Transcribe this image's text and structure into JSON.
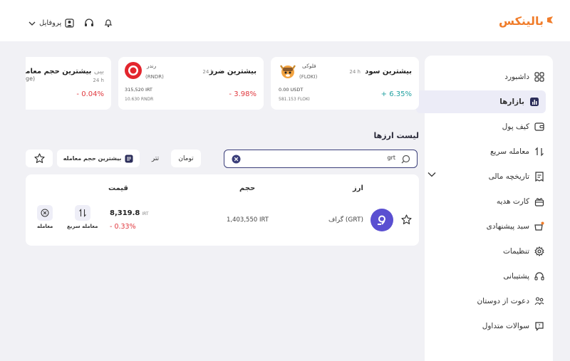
{
  "header": {
    "logo_text": "بالینکس",
    "profile_label": "پروفایل"
  },
  "sidebar": {
    "items": [
      {
        "label": "داشبورد",
        "icon": "dashboard-grid-icon"
      },
      {
        "label": "بازارها",
        "icon": "chart-box-icon",
        "active": true
      },
      {
        "label": "کیف پول",
        "icon": "wallet-icon"
      },
      {
        "label": "معامله سریع",
        "icon": "swap-arrows-icon"
      },
      {
        "label": "تاریخچه مالی",
        "icon": "receipt-icon",
        "expandable": true
      },
      {
        "label": "کارت هدیه",
        "icon": "gift-icon"
      },
      {
        "label": "سبد پیشنهادی",
        "icon": "basket-icon"
      },
      {
        "label": "تنظیمات",
        "icon": "gear-icon"
      },
      {
        "label": "پشتیبانی",
        "icon": "headset-icon"
      },
      {
        "label": "دعوت از دوستان",
        "icon": "people-icon"
      },
      {
        "label": "سوالات متداول",
        "icon": "question-chat-icon"
      }
    ]
  },
  "cards": [
    {
      "title": "بیشترین سود",
      "period": "24 h",
      "coin_name": "فلوکی",
      "coin_symbol": "(FLOKI)",
      "price": "0.00 USDT",
      "volume": "581.153 FLOKI",
      "change": "6.35%",
      "change_sign": "+",
      "color": "#21a1a1"
    },
    {
      "title": "بیشترین ضرر",
      "period": "24 h",
      "coin_name": "رندر",
      "coin_symbol": "(RNDR)",
      "price": "315,520 IRT",
      "volume": "10.630 RNDR",
      "change": "3.98%",
      "change_sign": "-",
      "color": "#e0383e"
    },
    {
      "title": "بیشترین حجم معامله",
      "title_suffix": "بیی",
      "period": "24 h",
      "coin_symbol": "ge)",
      "change": "0.04%",
      "change_sign": "-",
      "color": "#e0383e"
    }
  ],
  "market_list": {
    "title": "لیست ارزها",
    "search_value": "grt",
    "filters": {
      "toman": "تومان",
      "tether": "تتر",
      "top_volume": "بیشترین حجم معامله"
    },
    "columns": {
      "asset": "ارز",
      "volume": "حجم",
      "price": "قیمت"
    },
    "rows": [
      {
        "name": "گراف (GRT)",
        "volume": "1,403,550 IRT",
        "price": "8,319.8",
        "price_unit": "IRT",
        "change": "- 0.33%",
        "actions": {
          "quick_trade": "معامله سریع",
          "trade": "معامله"
        }
      }
    ]
  },
  "colors": {
    "accent": "#f07d2b",
    "primary": "#3b3f7a",
    "positive": "#21a1a1",
    "negative": "#e0383e",
    "active_bg": "#ececf7"
  }
}
